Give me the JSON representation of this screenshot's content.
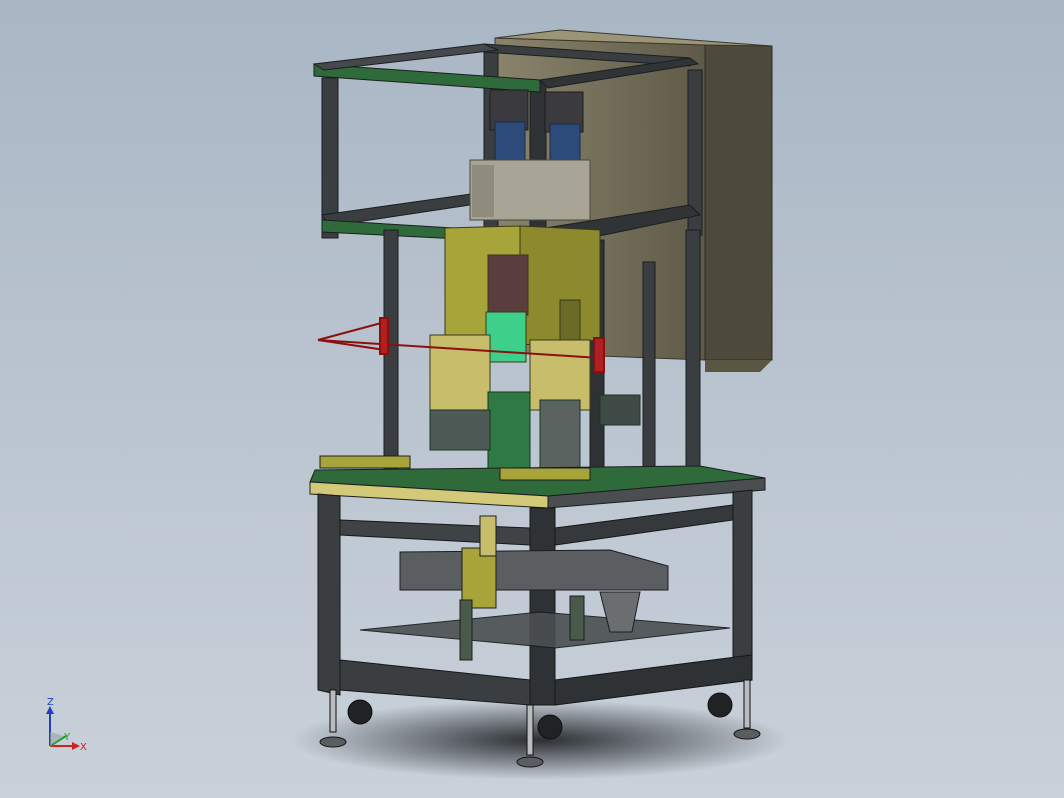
{
  "triad": {
    "z_label": "Z",
    "y_label": "Y",
    "x_label": "X",
    "colors": {
      "z": "#2040c0",
      "y": "#20a020",
      "x": "#d02020"
    }
  },
  "colors": {
    "background": "#b4c0cc",
    "frame": "#3a3e40",
    "frame_dark": "#24282a",
    "plate_green": "#2f6b3a",
    "cabinet": "#7a7560",
    "yellow_olive": "#a7a43a",
    "red_link": "#b02020",
    "cylinder_green": "#3ecf8a",
    "motor_blue": "#2d4b7a"
  }
}
